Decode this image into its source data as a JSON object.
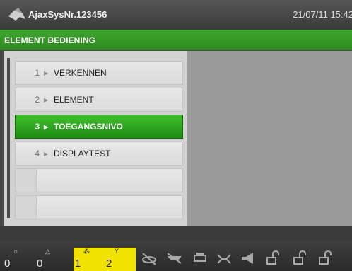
{
  "titlebar": {
    "system_name": "AjaxSysNr.123456",
    "datetime": "21/07/11 15:42"
  },
  "header": {
    "title": "ELEMENT BEDIENING"
  },
  "menu": {
    "items": [
      {
        "number": "1",
        "label": "VERKENNEN"
      },
      {
        "number": "2",
        "label": "ELEMENT"
      },
      {
        "number": "3",
        "label": "TOEGANGSNIVO",
        "active": true
      },
      {
        "number": "4",
        "label": "DISPLAYTEST"
      }
    ]
  },
  "statusbar": {
    "counters": [
      {
        "count": "0",
        "icon": "alarm-sun-icon",
        "symbol": "☼"
      },
      {
        "count": "0",
        "icon": "warning-icon",
        "symbol": "△"
      },
      {
        "count": "1",
        "icon": "people-icon",
        "symbol": "⁂",
        "highlight": "#f2e200"
      },
      {
        "count": "2",
        "icon": "fault-icon",
        "symbol": "Ϋ",
        "highlight": "#f2e200"
      }
    ],
    "icons": [
      "smoke-detector-off-icon",
      "sensor-off-icon",
      "printer-icon",
      "valve-icon",
      "horn-icon",
      "unlock-icon-1",
      "unlock-icon-2",
      "unlock-icon-3"
    ]
  },
  "colors": {
    "header_green": "#2d8a1f",
    "active_item": "#1d8a14",
    "highlight_yellow": "#f2e200"
  }
}
